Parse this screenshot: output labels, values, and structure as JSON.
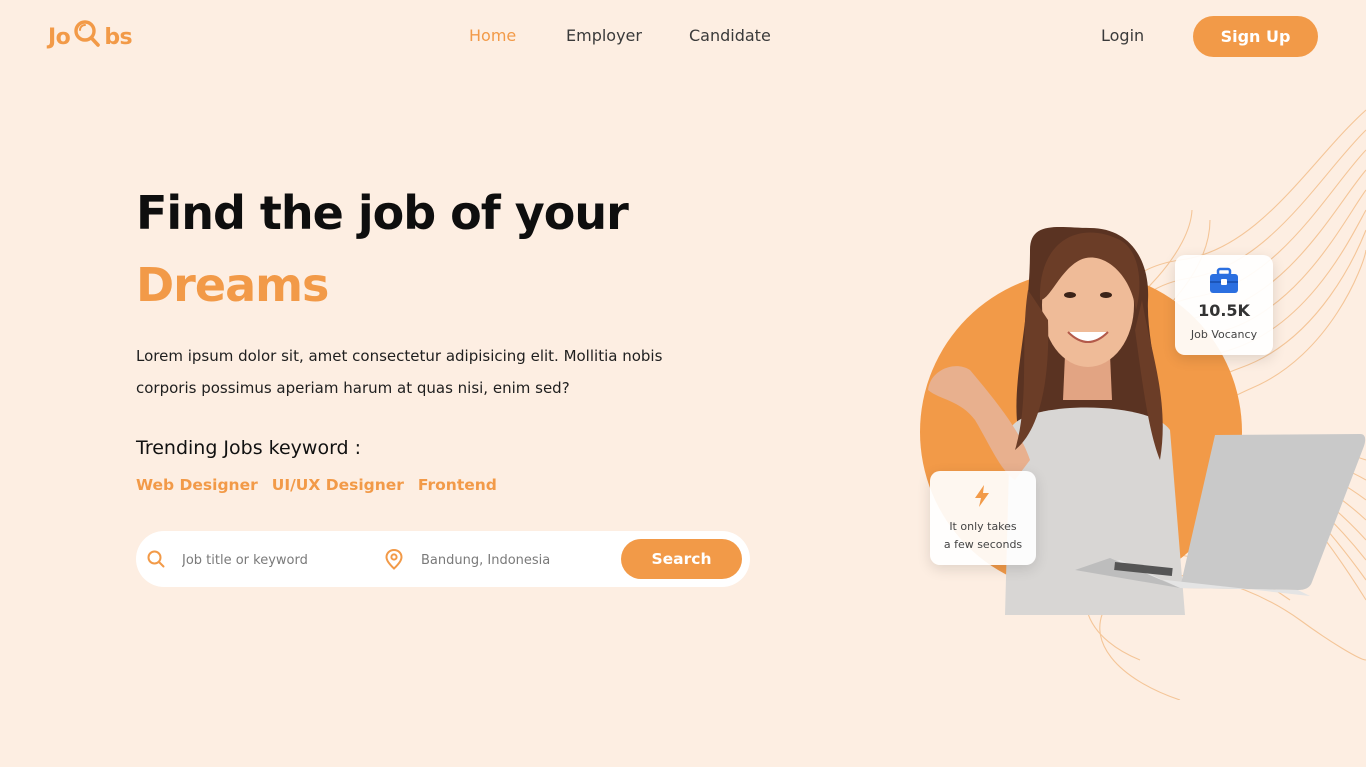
{
  "logo": {
    "left": "Jo",
    "right": "bs"
  },
  "nav": {
    "items": [
      {
        "label": "Home",
        "active": true
      },
      {
        "label": "Employer",
        "active": false
      },
      {
        "label": "Candidate",
        "active": false
      }
    ],
    "login": "Login",
    "signup": "Sign Up"
  },
  "hero": {
    "title_line1": "Find the job of your",
    "title_line2": "Dreams",
    "description": "Lorem ipsum dolor sit, amet consectetur adipisicing elit. Mollitia nobis corporis possimus aperiam harum at quas nisi, enim sed?",
    "trending_label": "Trending Jobs keyword :",
    "trending": [
      "Web Designer",
      "UI/UX Designer",
      "Frontend"
    ]
  },
  "search": {
    "keyword_placeholder": "Job title or keyword",
    "location_placeholder": "Bandung, Indonesia",
    "button": "Search"
  },
  "stats": {
    "vacancy_value": "10.5K",
    "vacancy_label": "Job Vocancy",
    "speed_label": "It only takes\na few seconds"
  },
  "colors": {
    "accent": "#f29a48",
    "background": "#fdeee2",
    "briefcase": "#2b6fe0"
  }
}
